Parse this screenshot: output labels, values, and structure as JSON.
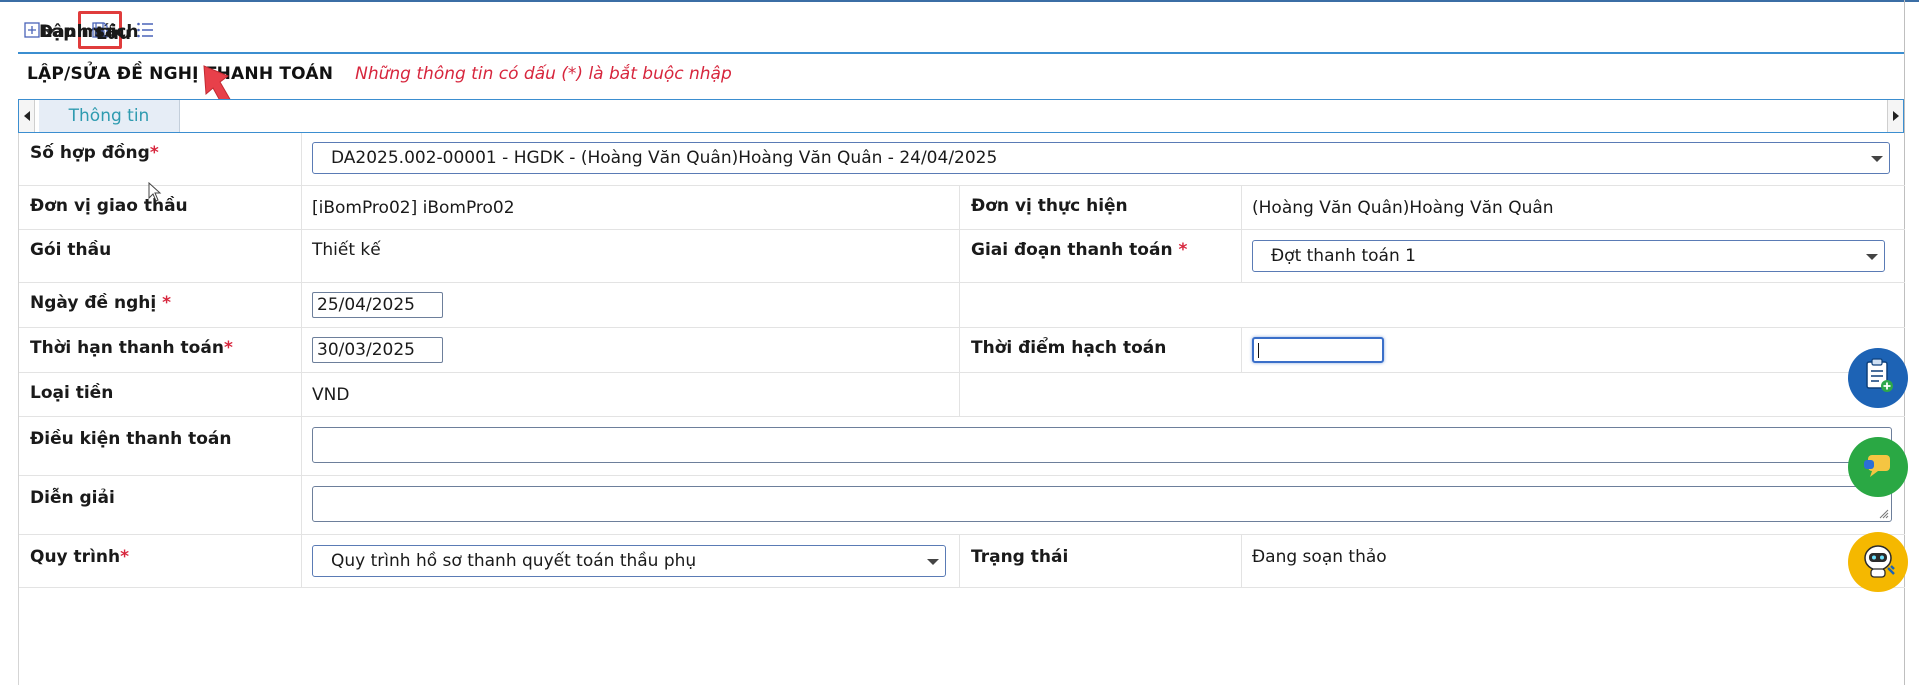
{
  "toolbar": {
    "new_label": "Lập mới",
    "save_label": "Lưu",
    "list_label": "Danh sách"
  },
  "page": {
    "title": "LẬP/SỬA ĐỀ NGHỊ THANH TOÁN",
    "required_note": "Những thông tin có dấu (*) là bắt buộc nhập"
  },
  "tabs": [
    {
      "label": "Thông tin",
      "active": true
    }
  ],
  "form": {
    "contract": {
      "label": "Số hợp đồng",
      "value": "DA2025.002-00001 - HGDK - (Hoàng Văn Quân)Hoàng Văn Quân - 24/04/2025"
    },
    "contractor_unit": {
      "label": "Đơn vị giao thầu",
      "value": "[iBomPro02] iBomPro02"
    },
    "executing_unit": {
      "label": "Đơn vị thực hiện",
      "value": "(Hoàng Văn Quân)Hoàng Văn Quân"
    },
    "package": {
      "label": "Gói thầu",
      "value": "Thiết kế"
    },
    "payment_phase": {
      "label": "Giai đoạn thanh toán",
      "value": "Đợt thanh toán 1"
    },
    "request_date": {
      "label": "Ngày đề nghị",
      "value": "25/04/2025"
    },
    "payment_deadline": {
      "label": "Thời hạn thanh toán",
      "value": "30/03/2025"
    },
    "accounting_time": {
      "label": "Thời điểm hạch toán",
      "value": ""
    },
    "currency": {
      "label": "Loại tiền",
      "value": "VND"
    },
    "payment_terms": {
      "label": "Điều kiện thanh toán",
      "value": ""
    },
    "description": {
      "label": "Diễn giải",
      "value": ""
    },
    "workflow": {
      "label": "Quy trình",
      "value": "Quy trình hồ sơ thanh quyết toán thầu phụ"
    },
    "status": {
      "label": "Trạng thái",
      "value": "Đang soạn thảo"
    },
    "required_mark": "*"
  },
  "colors": {
    "accent": "#1f3fb8",
    "required": "#d7263d",
    "highlight_box": "#e03c3c",
    "tab_text": "#2e9bb0"
  }
}
